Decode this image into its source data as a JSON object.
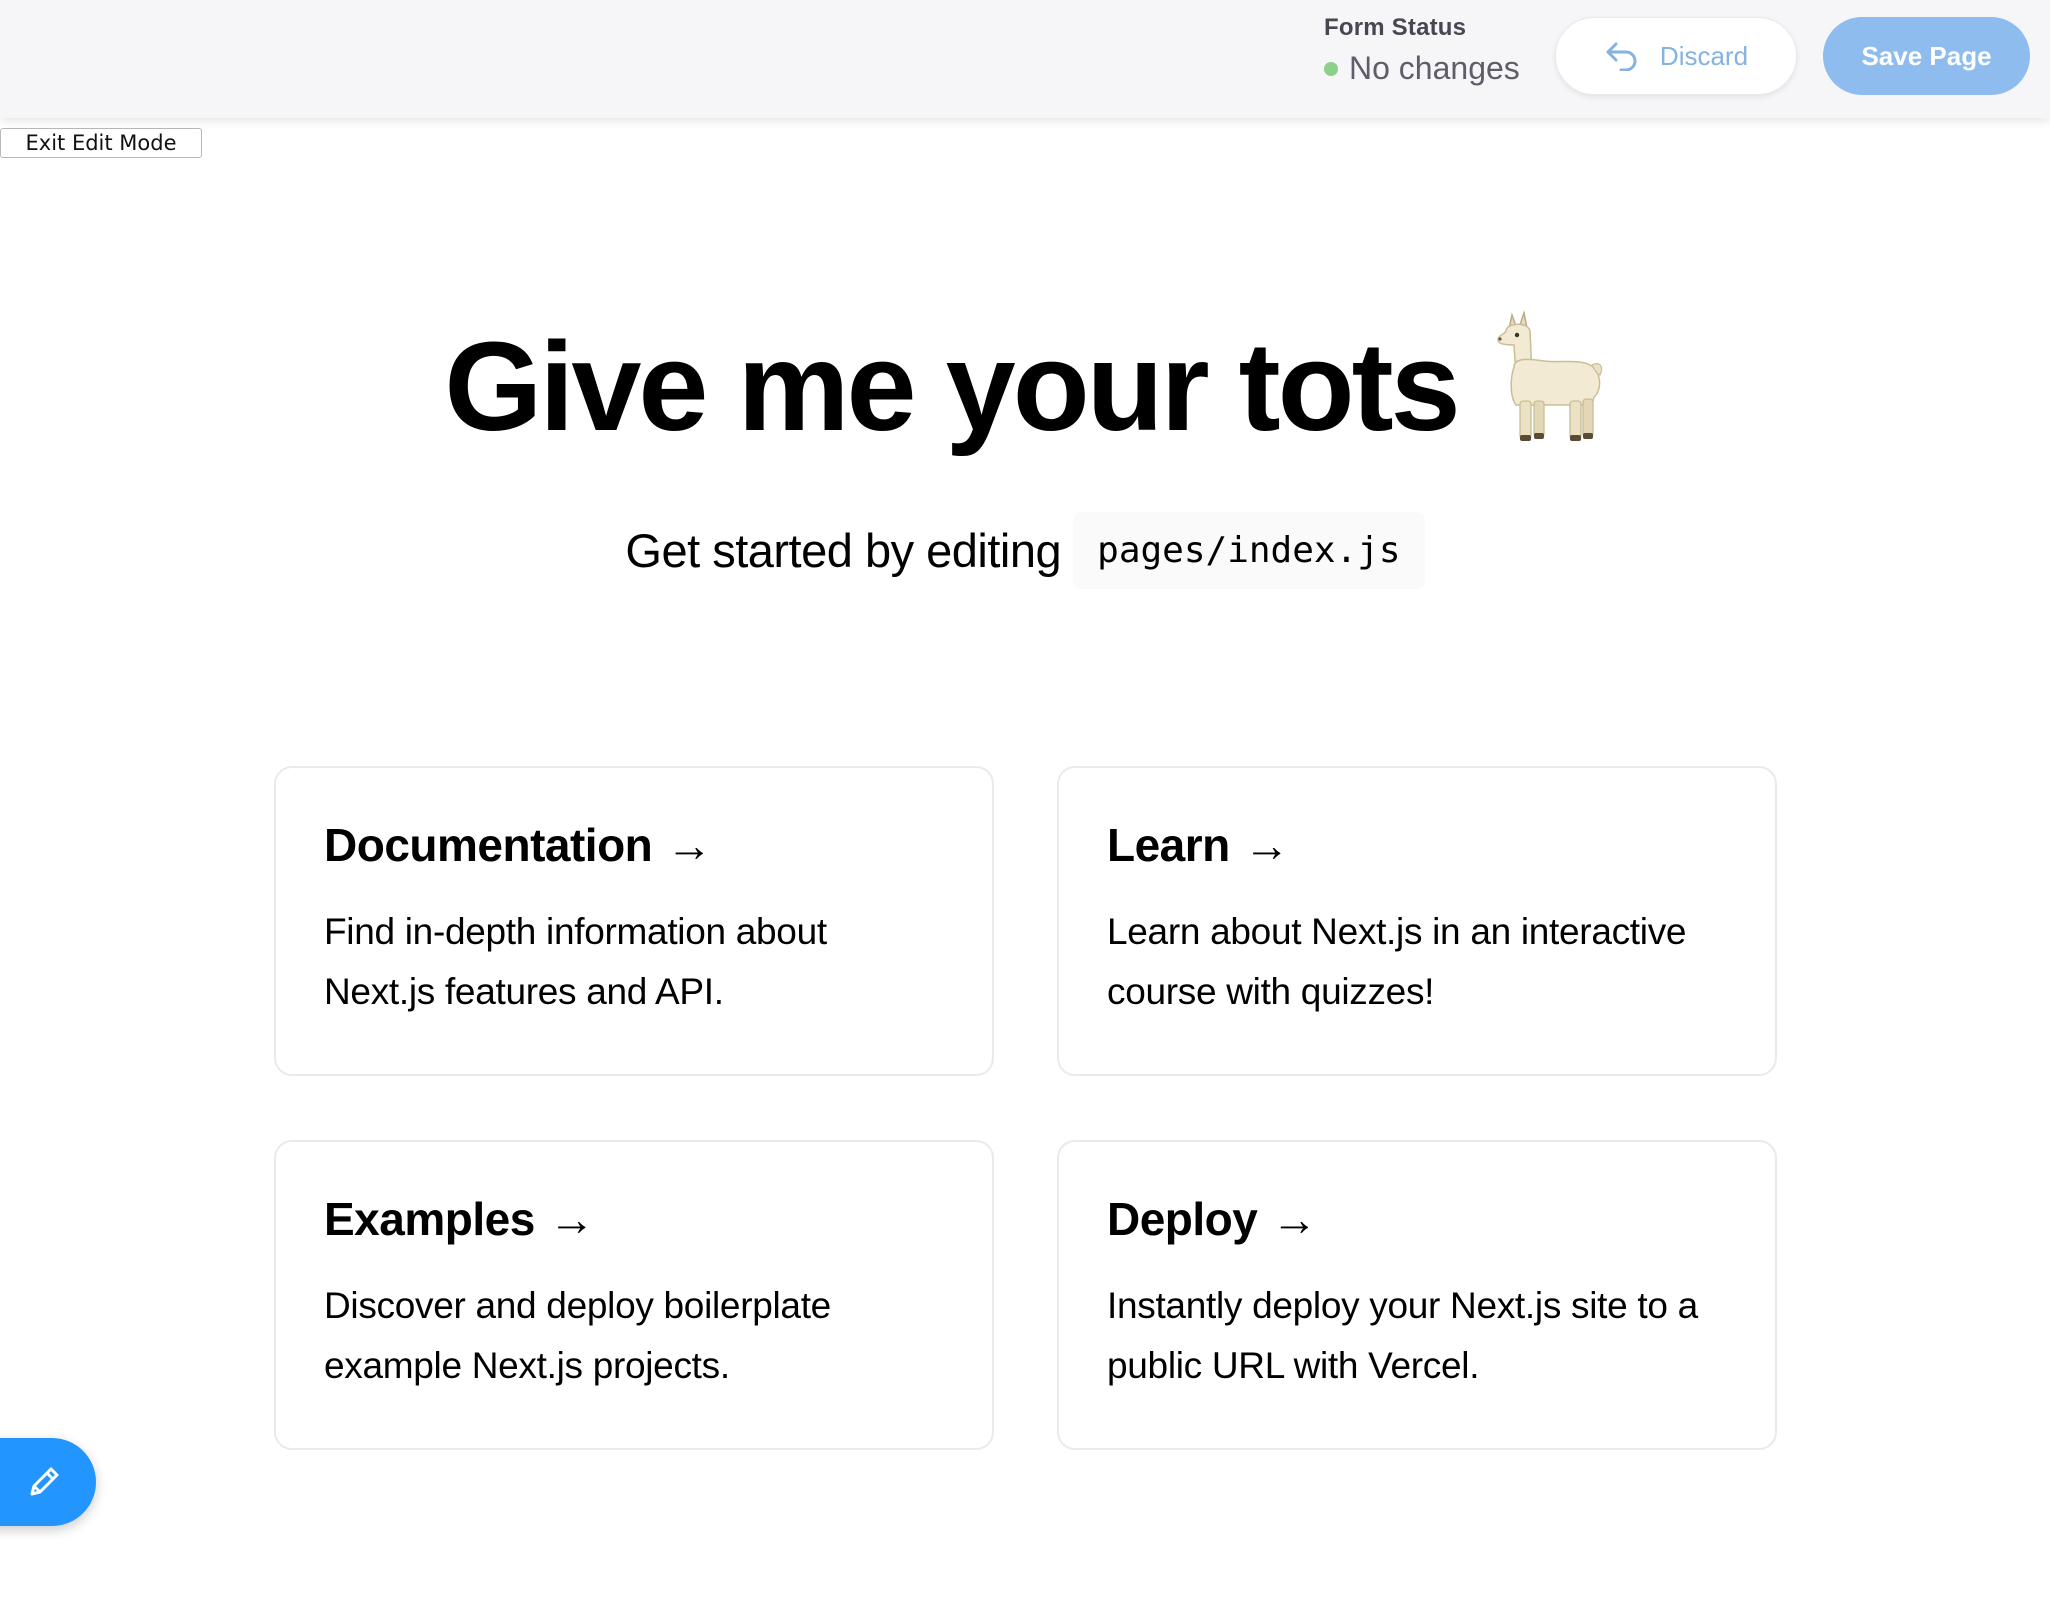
{
  "toolbar": {
    "form_status_title": "Form Status",
    "form_status_value": "No changes",
    "status_color": "#8cd08c",
    "discard_label": "Discard",
    "discard_icon": "undo-arrow-icon",
    "save_label": "Save Page",
    "accent_color": "#8ebcef"
  },
  "exit_edit_mode_label": "Exit Edit Mode",
  "hero": {
    "title": "Give me your tots",
    "emoji_icon": "llama-icon",
    "subtitle": "Get started by editing",
    "code_path": "pages/index.js"
  },
  "cards": [
    {
      "title": "Documentation",
      "arrow": "→",
      "description": "Find in-depth information about Next.js features and API."
    },
    {
      "title": "Learn",
      "arrow": "→",
      "description": "Learn about Next.js in an interactive course with quizzes!"
    },
    {
      "title": "Examples",
      "arrow": "→",
      "description": "Discover and deploy boilerplate example Next.js projects."
    },
    {
      "title": "Deploy",
      "arrow": "→",
      "description": "Instantly deploy your Next.js site to a public URL with Vercel."
    }
  ],
  "edit_fab": {
    "icon": "pencil-icon",
    "color": "#2296fe"
  }
}
